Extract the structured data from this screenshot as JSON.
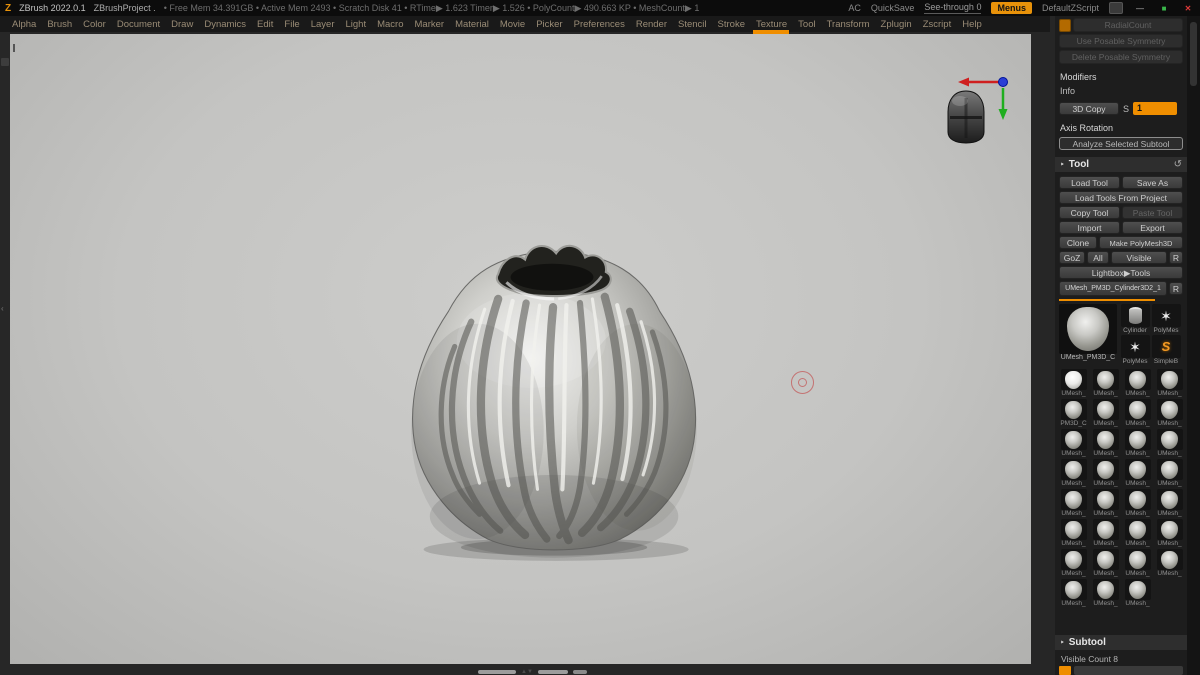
{
  "titlebar": {
    "app_title": "ZBrush 2022.0.1",
    "project_name": "ZBrushProject .",
    "stats": "• Free Mem 34.391GB • Active Mem 2493 • Scratch Disk 41 • RTime▶ 1.623  Timer▶ 1.526 • PolyCount▶ 490.663 KP • MeshCount▶ 1",
    "ac_label": "AC",
    "quicksave_label": "QuickSave",
    "see_through_label": "See-through 0",
    "menus_label": "Menus",
    "zscript_label": "DefaultZScript",
    "minimize_glyph": "—",
    "maximize_glyph": "■",
    "close_glyph": "✕"
  },
  "menubar": {
    "items": [
      "Alpha",
      "Brush",
      "Color",
      "Document",
      "Draw",
      "Dynamics",
      "Edit",
      "File",
      "Layer",
      "Light",
      "Macro",
      "Marker",
      "Material",
      "Movie",
      "Picker",
      "Preferences",
      "Render",
      "Stencil",
      "Stroke",
      "Texture",
      "Tool",
      "Transform",
      "Zplugin",
      "Zscript",
      "Help"
    ]
  },
  "panel": {
    "sym_items": [
      "RadialCount",
      "Use Posable Symmetry",
      "Delete Posable Symmetry"
    ],
    "modifiers_label": "Modifiers",
    "info_label": "Info",
    "copy3d_label": "3D Copy",
    "s_label": "S",
    "s_value": "1",
    "axis_rotation_label": "Axis Rotation",
    "analyze_label": "Analyze Selected Subtool",
    "tool_header": "Tool",
    "restore_glyph": "↺",
    "buttons": {
      "load_tool": "Load Tool",
      "save_as": "Save As",
      "load_from_project": "Load Tools From Project",
      "copy_tool": "Copy Tool",
      "paste_tool": "Paste Tool",
      "import_label": "Import",
      "export_label": "Export",
      "clone_label": "Clone",
      "make_polymesh": "Make PolyMesh3D",
      "goz": "GoZ",
      "all": "All",
      "visible": "Visible",
      "r": "R",
      "lightbox_tools": "Lightbox▶Tools"
    },
    "active_tool_name": "UMesh_PM3D_Cylinder3D2_1",
    "active_tool_r": "R",
    "current_tool_label": "UMesh_PM3D_C",
    "quick_items": [
      {
        "label": "Cylinder",
        "icon": "icon-cylinder",
        "glyph": ""
      },
      {
        "label": "PolyMes",
        "icon": "icon-star",
        "glyph": "✶"
      },
      {
        "label": "PolyMes",
        "icon": "icon-star",
        "glyph": "✶"
      },
      {
        "label": "SimpleB",
        "icon": "icon-sbrush",
        "glyph": "S"
      }
    ],
    "history_items": [
      "UMesh_",
      "UMesh_",
      "UMesh_",
      "UMesh_",
      "PM3D_C",
      "UMesh_",
      "UMesh_",
      "UMesh_",
      "UMesh_",
      "UMesh_",
      "UMesh_",
      "UMesh_",
      "UMesh_",
      "UMesh_",
      "UMesh_",
      "UMesh_",
      "UMesh_",
      "UMesh_",
      "UMesh_",
      "UMesh_",
      "UMesh_",
      "UMesh_",
      "UMesh_",
      "UMesh_",
      "UMesh_",
      "UMesh_",
      "UMesh_",
      "UMesh_",
      "UMesh_",
      "UMesh_",
      "UMesh_"
    ],
    "subtool_header": "Subtool",
    "visible_count_label": "Visible Count 8"
  }
}
